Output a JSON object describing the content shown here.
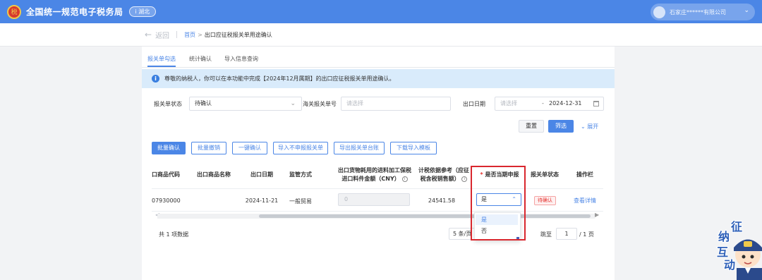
{
  "header": {
    "logo_char": "税",
    "app_title": "全国统一规范电子税务局",
    "env_badge": "i 湖北",
    "user_name": "石家庄******有限公司",
    "caret": "⌄"
  },
  "breadcrumb": {
    "back_arrow": "←",
    "back_label": "返回",
    "home": "首页",
    "separator": ">",
    "current": "出口应征税报关单用途确认"
  },
  "tabs": [
    {
      "label": "报关单勾选",
      "active": true
    },
    {
      "label": "统计确认",
      "active": false
    },
    {
      "label": "导入信息查询",
      "active": false
    }
  ],
  "notice": {
    "icon": "i",
    "text": "尊敬的纳税人，你可以在本功能中完成【2024年12月属期】的出口应征税报关单用途确认。"
  },
  "filters": {
    "status_label": "报关单状态",
    "status_value": "待确认",
    "customs_no_label": "海关报关单号",
    "customs_no_placeholder": "请选择",
    "export_date_label": "出口日期",
    "export_date_start_placeholder": "请选择",
    "date_dash": "-",
    "export_date_end": "2024-12-31",
    "caret": "⌄"
  },
  "filter_actions": {
    "reset": "重置",
    "filter": "筛选",
    "expand": "⌄ 展开"
  },
  "toolbar": {
    "batch_confirm": "批量确认",
    "batch_cancel": "批量撤销",
    "one_click_confirm": "一键确认",
    "import_no_declare": "导入不申报报关单",
    "export_ledger": "导出报关单台账",
    "download_template": "下载导入模板"
  },
  "table": {
    "headers": {
      "product_code": "口商品代码",
      "product_name": "出口商品名称",
      "export_date": "出口日期",
      "supervision": "监管方式",
      "material_amount_line1": "出口货物耗用的进料加工保税",
      "material_amount_line2": "进口料件金额（CNY）",
      "tax_basis_line1": "计税依据参考（应征",
      "tax_basis_line2": "税含税销售额）",
      "required_mark": "*",
      "declare_current": "是否当期申报",
      "status": "报关单状态",
      "actions": "操作栏",
      "help_icon": "i"
    },
    "rows": [
      {
        "product_code": "07930000",
        "product_name": "",
        "export_date": "2024-11-21",
        "supervision": "一般贸易",
        "material_amount": "0",
        "tax_basis": "24541.58",
        "declare_current": "是",
        "status": "待确认",
        "action": "查看详情"
      }
    ],
    "select_caret": "⌃"
  },
  "scrollbar": {
    "left_arrow": "◀",
    "right_arrow": "▶"
  },
  "pagination": {
    "total": "共 1 项数据",
    "page_size": "5 条/页",
    "jump_label": "跳至",
    "page_input": "1",
    "total_pages": "/ 1 页"
  },
  "dropdown": {
    "options": [
      "是",
      "否"
    ],
    "selected": "是"
  },
  "watermark": {
    "chars": [
      "征",
      "纳",
      "互",
      "动"
    ]
  },
  "colors": {
    "brand_blue": "#4b86e6",
    "highlight_red": "#d9272e",
    "notice_bg": "#d9ebfb"
  }
}
